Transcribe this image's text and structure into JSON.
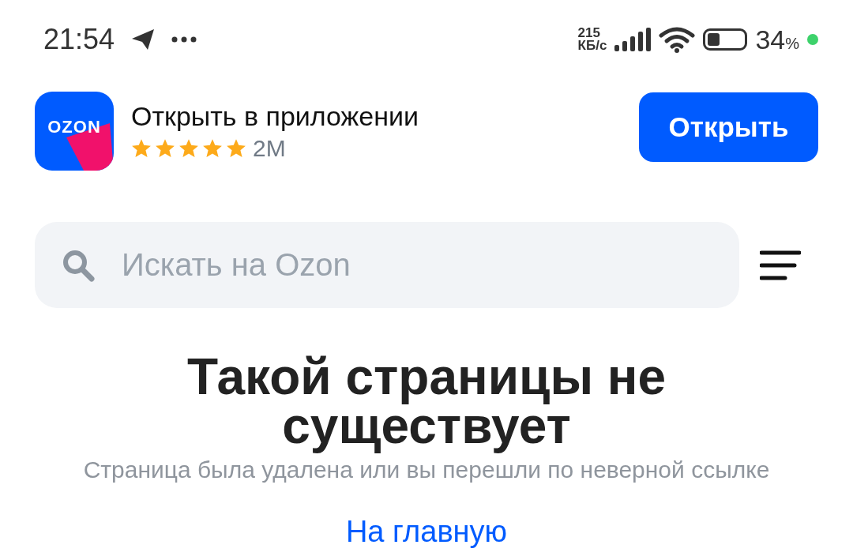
{
  "status_bar": {
    "time": "21:54",
    "speed_value": "215",
    "speed_unit": "КБ/с",
    "battery_percent": "34",
    "percent_sign": "%"
  },
  "app_banner": {
    "logo_text": "OZON",
    "title": "Открыть в приложении",
    "stars": 5,
    "rating_count": "2M",
    "button": "Открыть"
  },
  "search": {
    "placeholder": "Искать на Ozon"
  },
  "error": {
    "title": "Такой страницы не существует",
    "message": "Страница была удалена или вы перешли по неверной ссылке",
    "link": "На главную"
  }
}
